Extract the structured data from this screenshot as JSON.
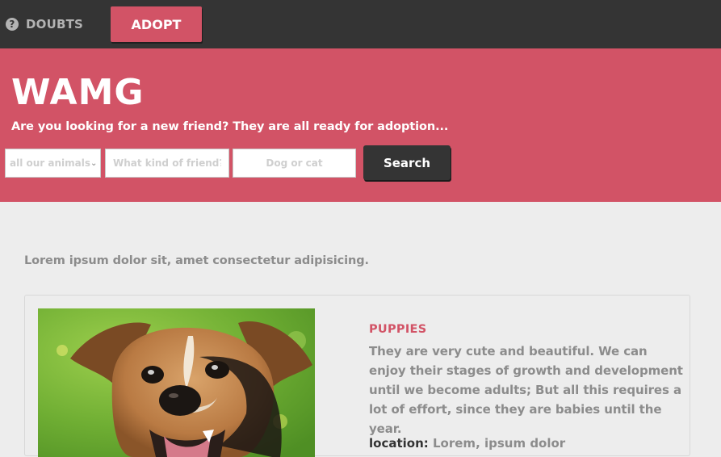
{
  "nav": {
    "doubts_label": "DOUBTS",
    "doubts_icon": "question-circle-icon",
    "adopt_label": "ADOPT"
  },
  "hero": {
    "title": "WAMG",
    "subtitle": "Are you looking for a new friend? They are all ready for adoption..."
  },
  "search": {
    "category_selected": "all our animals",
    "kind_placeholder": "What kind of friend?",
    "type_placeholder": "Dog or cat",
    "button_label": "Search"
  },
  "intro": "Lorem ipsum dolor sit, amet consectetur adipisicing.",
  "card": {
    "heading": "PUPPIES",
    "description": "They are very cute and beautiful. We can enjoy their stages of growth and development until we become adults; But all this requires a lot of effort, since they are babies until the year.",
    "location_label": "location:",
    "location_value": "Lorem, ipsum dolor"
  },
  "colors": {
    "brand": "#d25366",
    "dark": "#343434",
    "background": "#ededed",
    "muted_text": "#8c8c8c"
  }
}
